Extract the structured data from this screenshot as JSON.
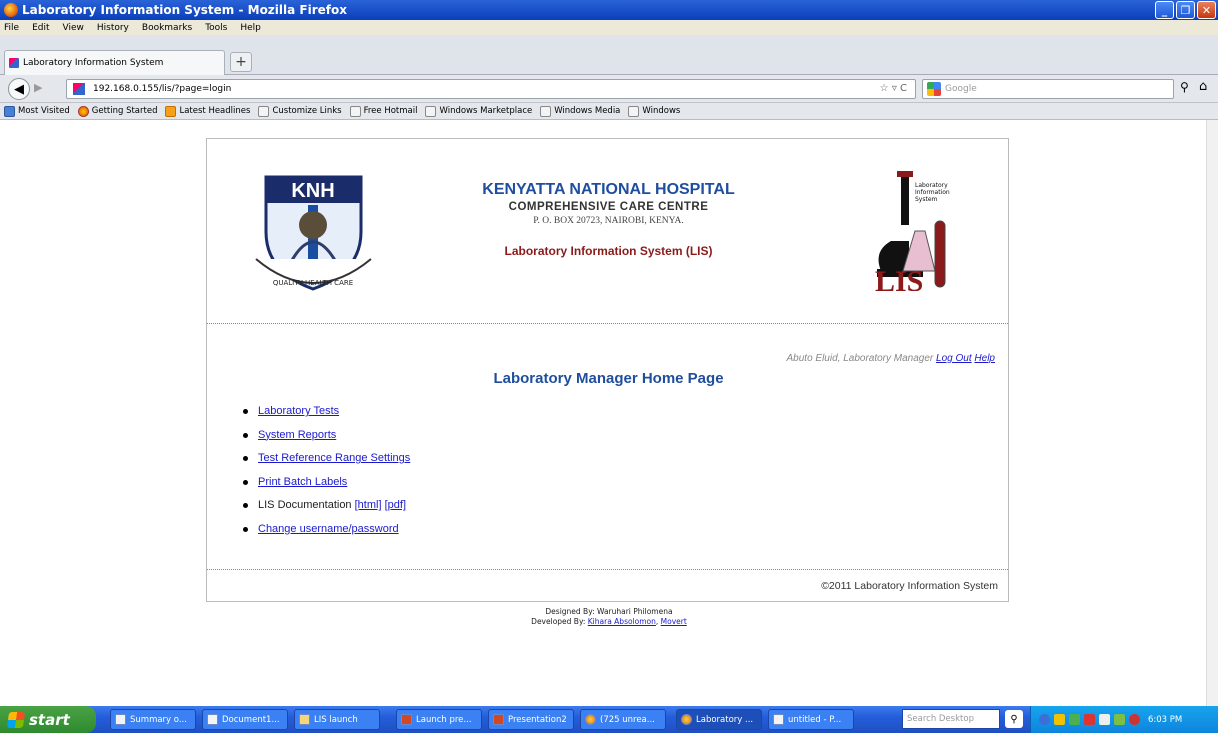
{
  "window": {
    "title": "Laboratory Information System - Mozilla Firefox"
  },
  "menubar": [
    "File",
    "Edit",
    "View",
    "History",
    "Bookmarks",
    "Tools",
    "Help"
  ],
  "tab": {
    "label": "Laboratory Information System",
    "new_tab": "+"
  },
  "nav": {
    "url": "192.168.0.155/lis/?page=login",
    "search_placeholder": "Google"
  },
  "bookmarks": [
    "Most Visited",
    "Getting Started",
    "Latest Headlines",
    "Customize Links",
    "Free Hotmail",
    "Windows Marketplace",
    "Windows Media",
    "Windows"
  ],
  "header": {
    "hospital": "KENYATTA NATIONAL HOSPITAL",
    "centre": "COMPREHENSIVE CARE CENTRE",
    "address": "P. O. BOX 20723, NAIROBI, KENYA.",
    "system": "Laboratory Information System (LIS)",
    "knh_logo_text": "KNH",
    "knh_motto": "QUALITY HEALTH CARE",
    "lis_logo_lines": [
      "Laboratory",
      "Information",
      "System"
    ],
    "lis_logo_big": "LIS"
  },
  "user": {
    "name": "Abuto Eluid, Laboratory Manager",
    "logout": "Log Out",
    "help": "Help"
  },
  "home": {
    "title": "Laboratory Manager Home Page",
    "links": {
      "lab_tests": "Laboratory Tests",
      "reports": "System Reports",
      "ref_ranges": "Test Reference Range Settings",
      "batch_labels": "Print Batch Labels",
      "doc_label": "LIS Documentation",
      "doc_html": "[html]",
      "doc_pdf": "[pdf]",
      "change_pw": "Change username/password"
    }
  },
  "footer": {
    "copyright": "©2011 Laboratory Information System",
    "designed": "Designed By: Waruhari Philomena",
    "developed_prefix": "Developed By:",
    "dev1": "Kihara Absolomon",
    "dev2": "Movert"
  },
  "taskbar": {
    "start": "start",
    "items": [
      "Summary o...",
      "Document1...",
      "LIS launch",
      "Launch pre...",
      "Presentation2",
      "(725 unrea...",
      "Laboratory ...",
      "untitled - P..."
    ],
    "search_placeholder": "Search Desktop",
    "clock": "6:03 PM"
  }
}
